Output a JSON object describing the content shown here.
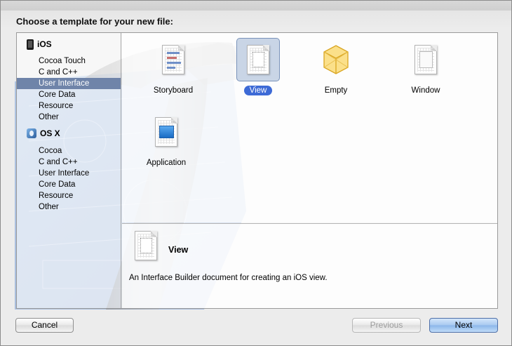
{
  "dialog": {
    "heading": "Choose a template for your new file:"
  },
  "sidebar": {
    "groups": [
      {
        "name": "iOS",
        "icon": "iphone-icon",
        "items": [
          "Cocoa Touch",
          "C and C++",
          "User Interface",
          "Core Data",
          "Resource",
          "Other"
        ]
      },
      {
        "name": "OS X",
        "icon": "osx-icon",
        "items": [
          "Cocoa",
          "C and C++",
          "User Interface",
          "Core Data",
          "Resource",
          "Other"
        ]
      }
    ],
    "selected": {
      "group": "iOS",
      "item": "User Interface"
    }
  },
  "templates": [
    {
      "label": "Storyboard",
      "icon": "storyboard-icon"
    },
    {
      "label": "View",
      "icon": "view-icon",
      "selected": true
    },
    {
      "label": "Empty",
      "icon": "empty-cube-icon"
    },
    {
      "label": "Window",
      "icon": "window-icon"
    },
    {
      "label": "Application",
      "icon": "application-icon"
    }
  ],
  "detail": {
    "title": "View",
    "description": "An Interface Builder document for creating an iOS view."
  },
  "buttons": {
    "cancel": "Cancel",
    "previous": "Previous",
    "next": "Next"
  },
  "colors": {
    "selection_sidebar": "#6f84a9",
    "selection_label": "#3d6ad6",
    "default_button": "#8bb6ea"
  }
}
